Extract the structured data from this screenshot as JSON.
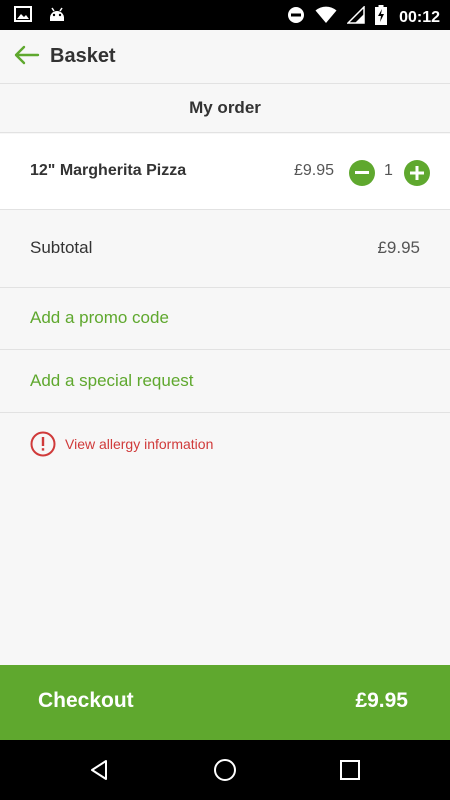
{
  "status_bar": {
    "time": "00:12",
    "icons": [
      "image-icon",
      "android-icon",
      "do-not-disturb-icon",
      "wifi-icon",
      "signal-icon",
      "battery-charging-icon"
    ]
  },
  "app_bar": {
    "title": "Basket",
    "back_icon": "arrow-left-icon"
  },
  "section": {
    "title": "My order"
  },
  "order_items": [
    {
      "name": "12\" Margherita Pizza",
      "price": "£9.95",
      "quantity": "1"
    }
  ],
  "summary": {
    "subtotal_label": "Subtotal",
    "subtotal_value": "£9.95",
    "promo_label": "Add a promo code",
    "request_label": "Add a special request"
  },
  "allergy": {
    "text": "View allergy information"
  },
  "checkout": {
    "label": "Checkout",
    "total": "£9.95"
  },
  "colors": {
    "accent": "#5fa82e",
    "warning": "#d03a3a"
  }
}
